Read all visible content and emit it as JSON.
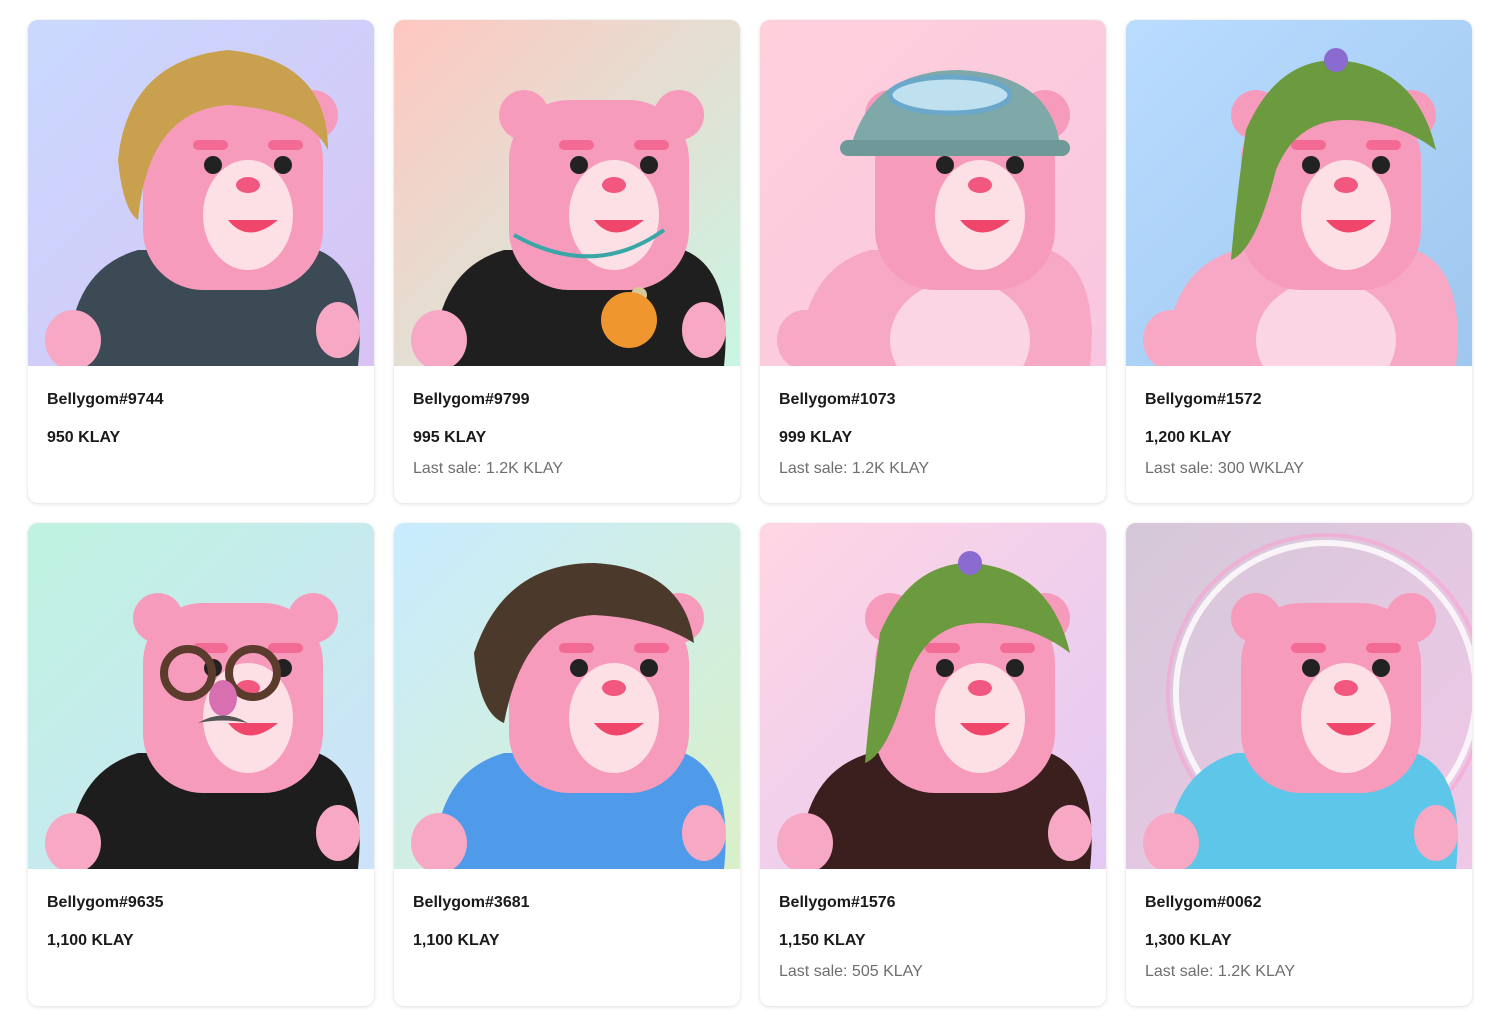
{
  "items": [
    {
      "name": "Bellygom#9744",
      "price": "950 KLAY",
      "last_sale": "",
      "bg": [
        "#c9d9ff",
        "#d8c3f4"
      ],
      "outfit": "#3b4a55",
      "hair": "#c9a04d",
      "acc": "hair-blonde"
    },
    {
      "name": "Bellygom#9799",
      "price": "995 KLAY",
      "last_sale": "Last sale: 1.2K KLAY",
      "bg": [
        "#ffc7c0",
        "#c9f6e4"
      ],
      "outfit": "#1f1f1f",
      "hair": "",
      "acc": "necklace"
    },
    {
      "name": "Bellygom#1073",
      "price": "999 KLAY",
      "last_sale": "Last sale: 1.2K KLAY",
      "bg": [
        "#ffd0dc",
        "#f8c6e0"
      ],
      "outfit": "",
      "hair": "#7fa8a8",
      "acc": "cap"
    },
    {
      "name": "Bellygom#1572",
      "price": "1,200 KLAY",
      "last_sale": "Last sale: 300 WKLAY",
      "bg": [
        "#b9dcff",
        "#9fc7ef"
      ],
      "outfit": "",
      "hair": "#6c9a3e",
      "acc": "hair-green"
    },
    {
      "name": "Bellygom#9635",
      "price": "1,100 KLAY",
      "last_sale": "",
      "bg": [
        "#bff3e0",
        "#cde2fb"
      ],
      "outfit": "#1d1d1d",
      "hair": "",
      "acc": "glasses"
    },
    {
      "name": "Bellygom#3681",
      "price": "1,100 KLAY",
      "last_sale": "",
      "bg": [
        "#c8ecff",
        "#d9f0c8"
      ],
      "outfit": "#4f9bea",
      "hair": "#4b3a2b",
      "acc": "hair-brown"
    },
    {
      "name": "Bellygom#1576",
      "price": "1,150 KLAY",
      "last_sale": "Last sale: 505 KLAY",
      "bg": [
        "#ffd6e3",
        "#e3c9f4"
      ],
      "outfit": "#3b1f1f",
      "hair": "#6c9a3e",
      "acc": "hair-green"
    },
    {
      "name": "Bellygom#0062",
      "price": "1,300 KLAY",
      "last_sale": "Last sale: 1.2K KLAY",
      "bg": [
        "#d4c8d8",
        "#f0c8e8"
      ],
      "outfit": "#5ec6e8",
      "hair": "",
      "acc": "halo"
    }
  ]
}
